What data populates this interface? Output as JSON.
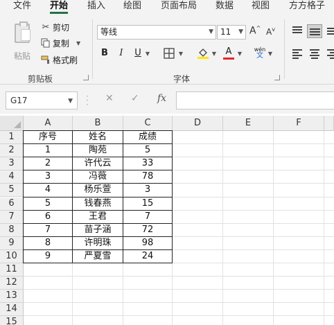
{
  "menu": {
    "tabs": [
      "文件",
      "开始",
      "插入",
      "绘图",
      "页面布局",
      "数据",
      "视图",
      "方方格子"
    ],
    "active": "开始"
  },
  "clipboard": {
    "paste_label": "粘贴",
    "cut_label": "剪切",
    "copy_label": "复制",
    "format_painter_label": "格式刷",
    "group_label": "剪贴板"
  },
  "font": {
    "font_name": "等线",
    "font_size": "11",
    "grow_label": "A",
    "shrink_label": "A",
    "bold_label": "B",
    "italic_label": "I",
    "underline_label": "U",
    "font_color_label": "A",
    "phonetic_top": "wén",
    "phonetic_bottom": "文",
    "group_label": "字体",
    "fill_color": "#ffe600",
    "font_color": "#e8242a"
  },
  "formula_bar": {
    "name_box": "G17",
    "cancel_icon": "✕",
    "enter_icon": "✓",
    "fx_label": "fx",
    "formula": ""
  },
  "sheet": {
    "columns": [
      "A",
      "B",
      "C",
      "D",
      "E",
      "F"
    ],
    "row_numbers": [
      "1",
      "2",
      "3",
      "4",
      "5",
      "6",
      "7",
      "8",
      "9",
      "10",
      "11",
      "12",
      "13",
      "14",
      "15"
    ],
    "rows": [
      [
        "序号",
        "姓名",
        "成绩"
      ],
      [
        "1",
        "陶苑",
        "5"
      ],
      [
        "2",
        "许代云",
        "33"
      ],
      [
        "3",
        "冯薇",
        "78"
      ],
      [
        "4",
        "杨乐萱",
        "3"
      ],
      [
        "5",
        "钱春燕",
        "15"
      ],
      [
        "6",
        "王君",
        "7"
      ],
      [
        "7",
        "苗子涵",
        "72"
      ],
      [
        "8",
        "许明珠",
        "98"
      ],
      [
        "9",
        "严夏雪",
        "24"
      ]
    ]
  }
}
